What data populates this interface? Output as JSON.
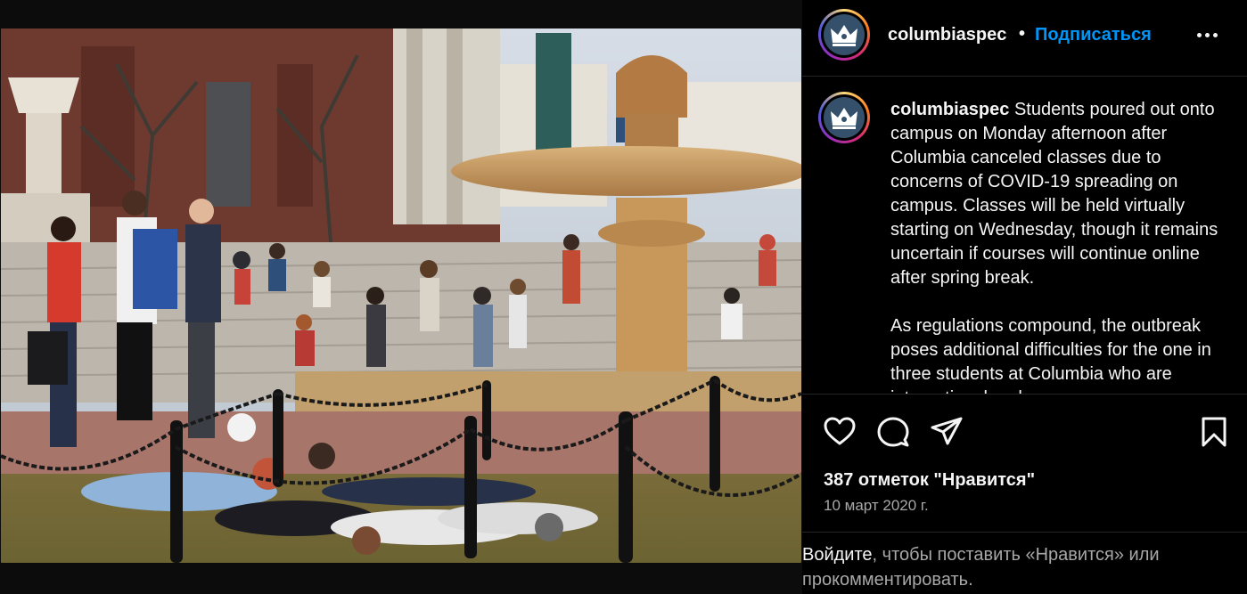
{
  "post": {
    "username": "columbiaspec",
    "separator": "•",
    "follow_label": "Подписаться",
    "caption_user": "columbiaspec",
    "caption_text": " Students poured out onto campus on Monday afternoon after Columbia canceled classes due to concerns of COVID-19 spreading on campus. Classes will be held virtually starting on Wednesday, though it remains uncertain if courses will continue online after spring break.\n\nAs regulations compound, the outbreak poses additional difficulties for the one in three students at Columbia who are international and",
    "likes_text": "387 отметок \"Нравится\"",
    "date_text": "10 март 2020 г."
  },
  "login_prompt": {
    "link_text": "Войдите",
    "rest_text": ", чтобы поставить «Нравится» или прокомментировать."
  },
  "icons": {
    "more": "more-options-icon",
    "like": "heart-icon",
    "comment": "comment-icon",
    "share": "share-icon",
    "save": "bookmark-icon",
    "avatar": "crown-logo-icon"
  },
  "colors": {
    "background": "#000000",
    "follow_blue": "#0095f6",
    "secondary_text": "#a8a8a8",
    "divider": "#262626"
  }
}
